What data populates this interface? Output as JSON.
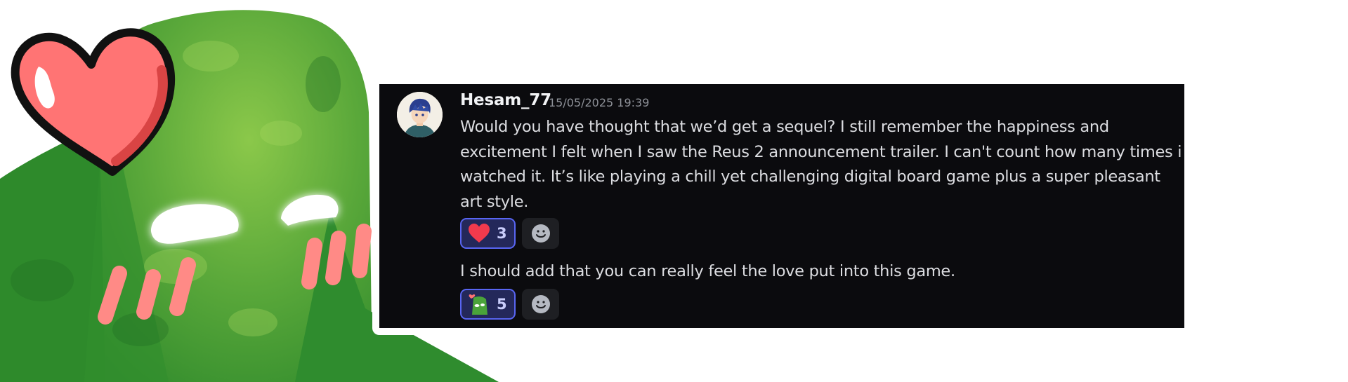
{
  "message": {
    "username": "Hesam_77",
    "timestamp": "15/05/2025 19:39",
    "lines": [
      "Would you have thought that we’d get a sequel? I still remember the happiness and",
      "excitement I felt when I saw the Reus 2 announcement trailer. I can't count how many times i",
      "watched it. It’s like playing a chill yet challenging digital board game plus a super pleasant",
      "art style."
    ],
    "followup": "I should add that you can really feel the love put into this game."
  },
  "reactions": [
    {
      "emoji": "heart-icon",
      "count": "3"
    },
    {
      "emoji": "green-mascot-heart-icon",
      "count": "5"
    }
  ],
  "colors": {
    "accent": "#5865f2",
    "panel_bg": "#0b0b0e",
    "heart": "#f13a4d",
    "mascot_green": "#3e9a2c"
  }
}
